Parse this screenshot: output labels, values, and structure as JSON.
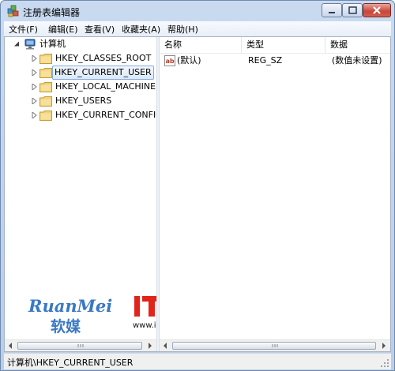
{
  "window": {
    "title": "注册表编辑器"
  },
  "menu": {
    "items": [
      "文件(F)",
      "编辑(E)",
      "查看(V)",
      "收藏夹(A)",
      "帮助(H)"
    ]
  },
  "tree": {
    "root": "计算机",
    "nodes": [
      {
        "label": "HKEY_CLASSES_ROOT",
        "selected": false
      },
      {
        "label": "HKEY_CURRENT_USER",
        "selected": true
      },
      {
        "label": "HKEY_LOCAL_MACHINE",
        "selected": false
      },
      {
        "label": "HKEY_USERS",
        "selected": false
      },
      {
        "label": "HKEY_CURRENT_CONFIG",
        "selected": false
      }
    ]
  },
  "values": {
    "columns": [
      "名称",
      "类型",
      "数据"
    ],
    "rows": [
      {
        "name": "(默认)",
        "type": "REG_SZ",
        "data": "(数值未设置)"
      }
    ]
  },
  "status": {
    "path": "计算机\\HKEY_CURRENT_USER"
  },
  "watermarks": {
    "ruanmei_latin": "RuanMei",
    "ruanmei_cjk": "软媒",
    "ithome_site": "www.ithome.com"
  },
  "colors": {
    "selection_border": "#84acdd",
    "brand_blue": "#3a78c4",
    "ithome_red": "#e1251b"
  }
}
